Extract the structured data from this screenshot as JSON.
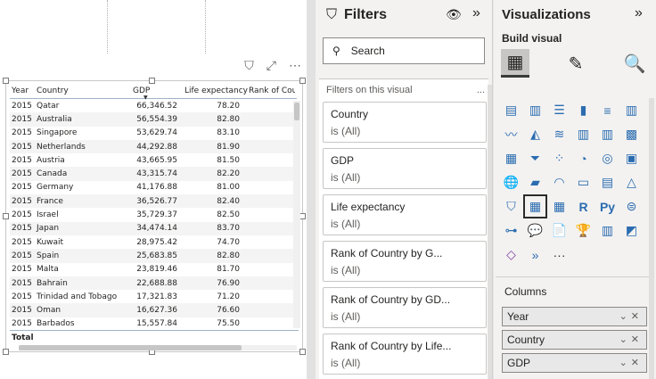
{
  "table": {
    "headers": {
      "year": "Year",
      "country": "Country",
      "gdp": "GDP",
      "life": "Life expectancy",
      "rank": "Rank of Count"
    },
    "rows": [
      {
        "year": "2015",
        "country": "Qatar",
        "gdp": "66,346.52",
        "life": "78.20"
      },
      {
        "year": "2015",
        "country": "Australia",
        "gdp": "56,554.39",
        "life": "82.80"
      },
      {
        "year": "2015",
        "country": "Singapore",
        "gdp": "53,629.74",
        "life": "83.10"
      },
      {
        "year": "2015",
        "country": "Netherlands",
        "gdp": "44,292.88",
        "life": "81.90"
      },
      {
        "year": "2015",
        "country": "Austria",
        "gdp": "43,665.95",
        "life": "81.50"
      },
      {
        "year": "2015",
        "country": "Canada",
        "gdp": "43,315.74",
        "life": "82.20"
      },
      {
        "year": "2015",
        "country": "Germany",
        "gdp": "41,176.88",
        "life": "81.00"
      },
      {
        "year": "2015",
        "country": "France",
        "gdp": "36,526.77",
        "life": "82.40"
      },
      {
        "year": "2015",
        "country": "Israel",
        "gdp": "35,729.37",
        "life": "82.50"
      },
      {
        "year": "2015",
        "country": "Japan",
        "gdp": "34,474.14",
        "life": "83.70"
      },
      {
        "year": "2015",
        "country": "Kuwait",
        "gdp": "28,975.42",
        "life": "74.70"
      },
      {
        "year": "2015",
        "country": "Spain",
        "gdp": "25,683.85",
        "life": "82.80"
      },
      {
        "year": "2015",
        "country": "Malta",
        "gdp": "23,819.46",
        "life": "81.70"
      },
      {
        "year": "2015",
        "country": "Bahrain",
        "gdp": "22,688.88",
        "life": "76.90"
      },
      {
        "year": "2015",
        "country": "Trinidad and Tobago",
        "gdp": "17,321.83",
        "life": "71.20"
      },
      {
        "year": "2015",
        "country": "Oman",
        "gdp": "16,627.36",
        "life": "76.60"
      },
      {
        "year": "2015",
        "country": "Barbados",
        "gdp": "15,557.84",
        "life": "75.50"
      }
    ],
    "total_label": "Total"
  },
  "filters": {
    "title": "Filters",
    "search_placeholder": "Search",
    "section_title": "Filters on this visual",
    "more": "...",
    "cards": [
      {
        "name": "Country",
        "state": "is (All)"
      },
      {
        "name": "GDP",
        "state": "is (All)"
      },
      {
        "name": "Life expectancy",
        "state": "is (All)"
      },
      {
        "name": "Rank of Country by G...",
        "state": "is (All)"
      },
      {
        "name": "Rank of Country by GD...",
        "state": "is (All)"
      },
      {
        "name": "Rank of Country by Life...",
        "state": "is (All)"
      }
    ]
  },
  "viz": {
    "title": "Visualizations",
    "build_label": "Build visual",
    "columns_label": "Columns",
    "wells": [
      "Year",
      "Country",
      "GDP"
    ],
    "r_label": "R",
    "py_label": "Py",
    "more": "···"
  }
}
